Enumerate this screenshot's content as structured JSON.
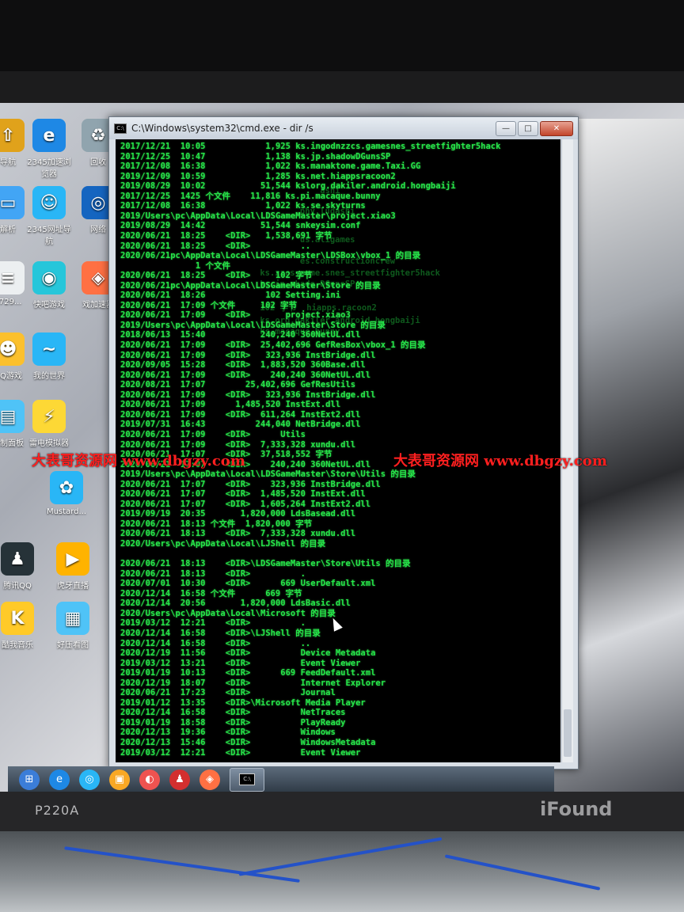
{
  "window": {
    "title": "C:\\Windows\\system32\\cmd.exe - dir /s",
    "min": "—",
    "max": "□",
    "close": "✕"
  },
  "desktop_icons": [
    {
      "label": "导航",
      "icon": "nav-icon",
      "color": "#e0a21b",
      "glyph": "⇧"
    },
    {
      "label": "2345加速浏览器",
      "icon": "browser-icon",
      "color": "#1e88e5",
      "glyph": "e"
    },
    {
      "label": "回收",
      "icon": "recycle-bin-icon",
      "color": "#90a4ae",
      "glyph": "♻"
    },
    {
      "label": "解析",
      "icon": "monitor-icon",
      "color": "#42a5f5",
      "glyph": "▭"
    },
    {
      "label": "2345网址导航",
      "icon": "mascot-icon",
      "color": "#29b6f6",
      "glyph": "☺"
    },
    {
      "label": "网络",
      "icon": "network-icon",
      "color": "#1565c0",
      "glyph": "◎"
    },
    {
      "label": "7729...",
      "icon": "document-icon",
      "color": "#eceff1",
      "glyph": "≡"
    },
    {
      "label": "快吧游戏",
      "icon": "game-icon",
      "color": "#26c6da",
      "glyph": "◉"
    },
    {
      "label": "戏加速器",
      "icon": "accelerator-icon",
      "color": "#ff7043",
      "glyph": "◈"
    },
    {
      "label": "QQ游戏",
      "icon": "qq-game-icon",
      "color": "#fbc02d",
      "glyph": "☻"
    },
    {
      "label": "我的世界",
      "icon": "fish-icon",
      "color": "#29b6f6",
      "glyph": "~"
    },
    {
      "label": "雷电模拟器",
      "icon": "emulator-icon",
      "color": "#fdd835",
      "glyph": "⚡"
    },
    {
      "label": "控制面板",
      "icon": "control-panel-icon",
      "color": "#4fc3f7",
      "glyph": "▤"
    },
    {
      "label": "Mustard...",
      "icon": "mustard-icon",
      "color": "#29b6f6",
      "glyph": "✿"
    },
    {
      "label": "腾讯QQ",
      "icon": "qq-icon",
      "color": "#263238",
      "glyph": "♟"
    },
    {
      "label": "虎牙直播",
      "icon": "live-icon",
      "color": "#ffb300",
      "glyph": "▶"
    },
    {
      "label": "酷我音乐",
      "icon": "music-icon",
      "color": "#ffca28",
      "glyph": "K"
    },
    {
      "label": "好压看图",
      "icon": "image-viewer-icon",
      "color": "#4fc3f7",
      "glyph": "▦"
    }
  ],
  "console_lines": [
    "2017/12/21  10:05            1,925 ks.ingodnzzcs.gamesnes_streetfighter5hack",
    "2017/12/25  10:47            1,138 ks.jp.shadowDGunsSP",
    "2017/12/08  16:38            1,022 ks.manaktone.game.Taxi.GG",
    "2019/12/09  10:59            1,285 ks.net.hiappsracoon2",
    "2019/08/29  10:02           51,544 kslorg.dakiler.android.hongbaiji",
    "2017/12/25  1425 个文件    11,816 ks.pi.macaque.bunny",
    "2017/12/08  16:38            1,022 ks.se.skyturns",
    "2019/Users\\pc\\AppData\\Local\\LDSGameMaster\\project.xiao3",
    "2019/08/29  14:42           51,544 snkeysim.conf",
    "2020/06/21  18:25    <DIR>   1,538,691 字节",
    "2020/06/21  18:25    <DIR>          ..",
    "2020/06/21pc\\AppData\\Local\\LDSGameMaster\\LDSBox\\vbox_1 的目录",
    "               1 个文件",
    "2020/06/21  18:25    <DIR>     102 字节",
    "2020/06/21pc\\AppData\\Local\\LDSGameMaster\\Store 的目录",
    "2020/06/21  18:26            102 Setting.ini",
    "2020/06/21  17:09 个文件     102 字节",
    "2020/06/21  17:09    <DIR>       project.xiao3",
    "2019/Users\\pc\\AppData\\Local\\LDSGameMaster\\Store 的目录",
    "2018/06/13  15:40           240,240 360NetUL.dll",
    "2020/06/21  17:09    <DIR>  25,402,696 GefResBox\\vbox_1 的目录",
    "2020/06/21  17:09    <DIR>   323,936 InstBridge.dll",
    "2020/09/05  15:28    <DIR>  1,883,520 360Base.dll",
    "2020/06/21  17:09    <DIR>    240,240 360NetUL.dll",
    "2020/08/21  17:07        25,402,696 GefResUtils",
    "2020/06/21  17:09    <DIR>   323,936 InstBridge.dll",
    "2020/06/21  17:09      1,485,520 InstExt.dll",
    "2020/06/21  17:09    <DIR>  611,264 InstExt2.dll",
    "2019/07/31  16:43          244,040 NetBridge.dll",
    "2020/06/21  17:09    <DIR>      Utils",
    "2020/06/21  17:09    <DIR>  7,333,328 xundu.dll",
    "2020/06/21  17:07    <DIR>  37,518,552 字节",
    "2020/06/21  17:07    <DIR>    240,240 360NetUL.dll",
    "2019/Users\\pc\\AppData\\Local\\LDSGameMaster\\Store\\Utils 的目录",
    "2020/06/21  17:07    <DIR>    323,936 InstBridge.dll",
    "2020/06/21  17:07    <DIR>  1,485,520 InstExt.dll",
    "2020/06/21  17:07    <DIR>  1,605,264 InstExt2.dll",
    "2019/09/19  20:35       1,820,000 LdsBasead.dll",
    "2020/06/21  18:13 个文件  1,820,000 字节",
    "2020/06/21  18:13    <DIR>  7,333,328 xundu.dll",
    "2020/Users\\pc\\AppData\\Local\\LJShell 的目录",
    "",
    "2020/06/21  18:13    <DIR>\\LDSGameMaster\\Store\\Utils 的目录",
    "2020/06/21  18:13    <DIR>          .",
    "2020/07/01  10:30    <DIR>      669 UserDefault.xml",
    "2020/12/14  16:58 个文件      669 字节",
    "2020/12/14  20:56       1,820,000 LdsBasic.dll",
    "2020/Users\\pc\\AppData\\Local\\Microsoft 的目录",
    "2019/03/12  12:21    <DIR>          .",
    "2020/12/14  16:58    <DIR>\\LJShell 的目录",
    "2020/12/14  16:58    <DIR>          ..",
    "2020/12/19  11:56    <DIR>          Device Metadata",
    "2019/03/12  13:21    <DIR>          Event Viewer",
    "2019/01/19  10:13    <DIR>      669 FeedDefault.xml",
    "2020/12/19  18:07    <DIR>          Internet Explorer",
    "2020/06/21  17:23    <DIR>          Journal",
    "2019/01/12  13:35    <DIR>\\Microsoft Media Player",
    "2020/12/14  16:58    <DIR>          NetTraces",
    "2019/01/19  18:58    <DIR>          PlayReady",
    "2020/12/13  19:36    <DIR>          Windows",
    "2020/12/13  15:46    <DIR>          WindowsMetadata",
    "2019/03/12  12:21    <DIR>          Event Viewer"
  ],
  "ghost_lines": [
    "                                      ashi",
    "                                  phy.ludashi",
    "                                  us.aligames",
    "                                  es.constructioncrew",
    "                          ks.zzcs.game.snes_streetfighter5hack",
    "                          ks.jp.shade.DGunsSP",
    "                          102 字节  hiapps.racoon2",
    "                          ks.org.dakiler.android.hongbaiji",
    "                          ks.macaque.bunny"
  ],
  "watermark": {
    "left_text": "大表哥资源网 www.dbgzy.com",
    "right_text": "大表哥资源网 www.dbgzy.com"
  },
  "taskbar": [
    {
      "name": "start-button",
      "icon": "windows-logo-icon",
      "color": "#3b7dd8",
      "glyph": "⊞"
    },
    {
      "name": "taskbar-browser",
      "icon": "browser-icon",
      "color": "#1e88e5",
      "glyph": "e"
    },
    {
      "name": "taskbar-2345",
      "icon": "ie-icon",
      "color": "#29b6f6",
      "glyph": "◎"
    },
    {
      "name": "taskbar-file-manager",
      "icon": "folder-icon",
      "color": "#f9a825",
      "glyph": "▣"
    },
    {
      "name": "taskbar-app",
      "icon": "app-icon",
      "color": "#ef5350",
      "glyph": "◐"
    },
    {
      "name": "taskbar-qq",
      "icon": "qq-icon",
      "color": "#d32f2f",
      "glyph": "♟"
    },
    {
      "name": "taskbar-accelerator",
      "icon": "accelerator-icon",
      "color": "#ff7043",
      "glyph": "◈"
    }
  ],
  "taskbar_cmd_glyph": "C:\\",
  "monitor": {
    "model": "P220A",
    "brand": "iFound"
  }
}
